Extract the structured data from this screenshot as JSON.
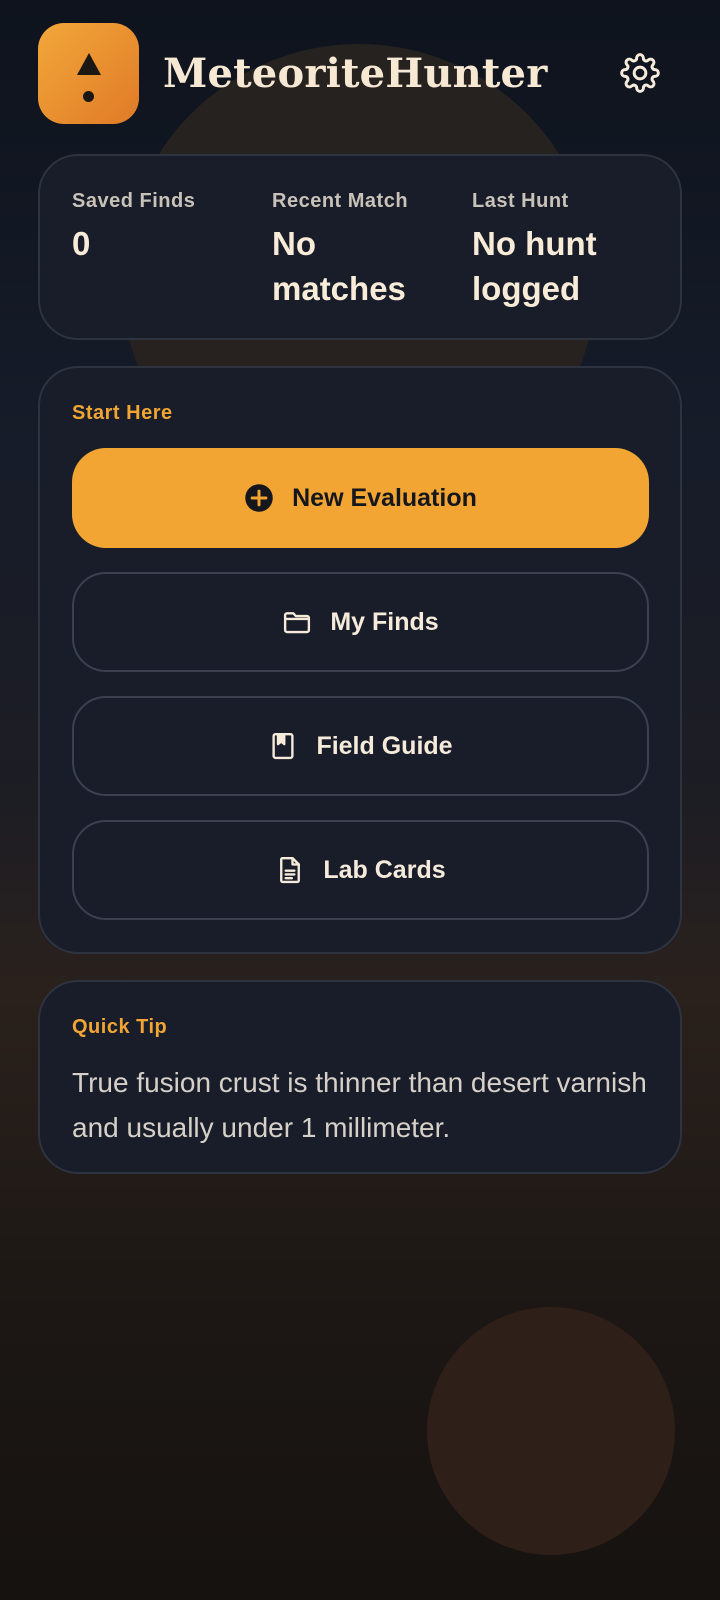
{
  "app": {
    "title": "MeteoriteHunter",
    "accent_color": "#f2a533",
    "icons": {
      "app": "meteor-icon",
      "settings": "gear-icon"
    }
  },
  "stats": [
    {
      "label": "Saved Finds",
      "value": "0"
    },
    {
      "label": "Recent Match",
      "value": "No matches"
    },
    {
      "label": "Last Hunt",
      "value": "No hunt logged"
    }
  ],
  "start": {
    "section_label": "Start Here",
    "buttons": [
      {
        "label": "New Evaluation",
        "icon": "plus-circle-icon"
      },
      {
        "label": "My Finds",
        "icon": "folder-icon"
      },
      {
        "label": "Field Guide",
        "icon": "bookmark-book-icon"
      },
      {
        "label": "Lab Cards",
        "icon": "document-icon"
      }
    ]
  },
  "tip": {
    "section_label": "Quick Tip",
    "text": "True fusion crust is thinner than desert varnish and usually under 1 millimeter."
  }
}
